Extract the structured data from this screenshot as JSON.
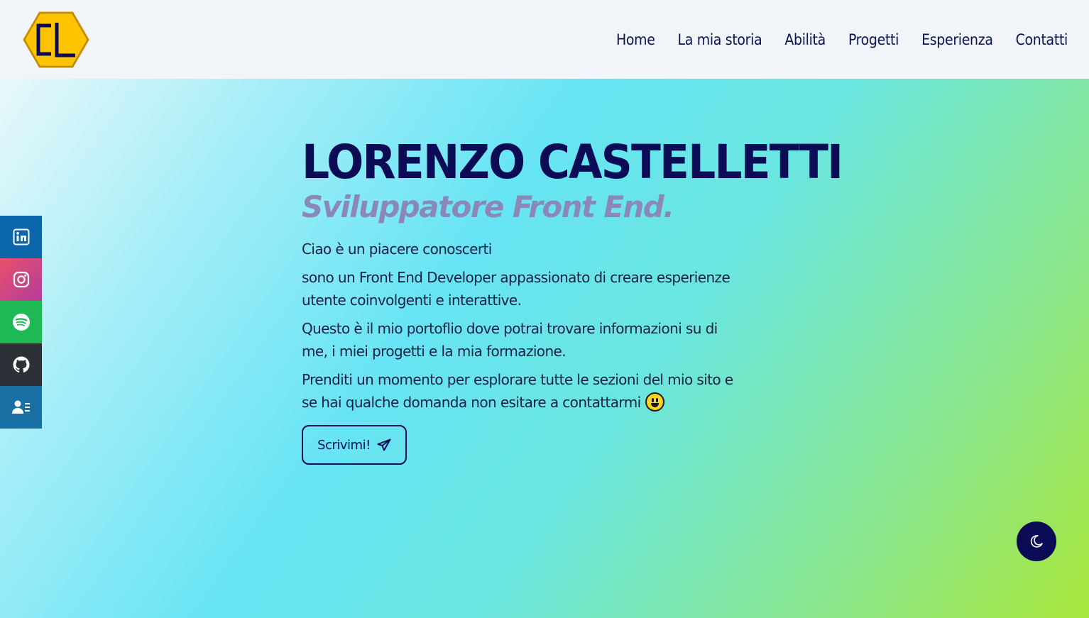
{
  "header": {
    "logo_text": "CL",
    "nav": [
      {
        "label": "Home"
      },
      {
        "label": "La mia storia"
      },
      {
        "label": "Abilità"
      },
      {
        "label": "Progetti"
      },
      {
        "label": "Esperienza"
      },
      {
        "label": "Contatti"
      }
    ]
  },
  "hero": {
    "title": "LORENZO CASTELLETTI",
    "subtitle": "Sviluppatore Front End.",
    "paragraphs": [
      "Ciao è un piacere conoscerti",
      "sono un Front End Developer appassionato di creare esperienze utente coinvolgenti e interattive.",
      "Questo è il mio portoflio dove potrai trovare informazioni su di me, i miei progetti e la mia formazione.",
      "Prenditi un momento per esplorare tutte le sezioni del mio sito e se hai qualche domanda non esitare a contattarmi"
    ],
    "cta_label": "Scrivimi!"
  },
  "social": [
    {
      "icon": "linkedin-icon",
      "color": "#0a66a8"
    },
    {
      "icon": "instagram-icon",
      "color": "#d84681"
    },
    {
      "icon": "spotify-icon",
      "color": "#1eb954"
    },
    {
      "icon": "github-icon",
      "color": "#2b3137"
    },
    {
      "icon": "contact-card-icon",
      "color": "#176fa4"
    }
  ],
  "theme_toggle": {
    "icon": "moon-icon"
  },
  "colors": {
    "brand_navy": "#0b0c55",
    "logo_yellow": "#ffc400",
    "subtitle_purple": "#8b87b6"
  }
}
